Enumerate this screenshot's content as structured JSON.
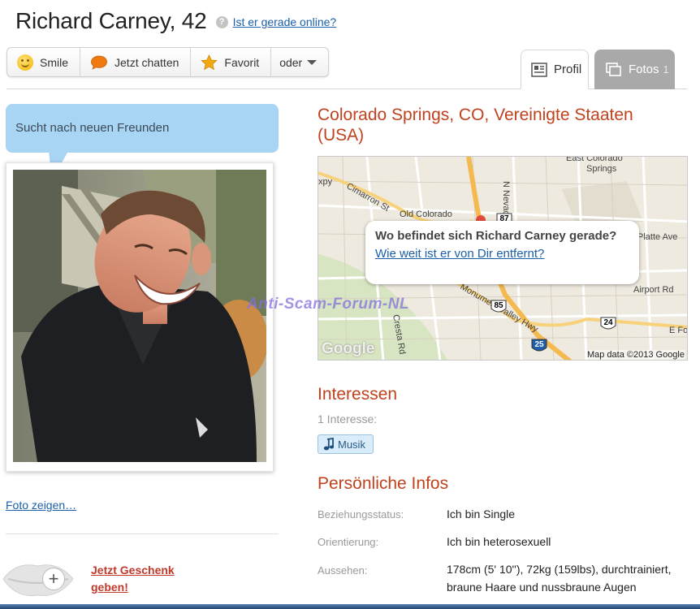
{
  "profile": {
    "name_age": "Richard Carney, 42",
    "online_link": "Ist er gerade online?",
    "help_glyph": "?"
  },
  "actions": [
    {
      "label": "Smile",
      "icon": "smile-icon"
    },
    {
      "label": "Jetzt chatten",
      "icon": "chat-bubble-icon"
    },
    {
      "label": "Favorit",
      "icon": "star-icon"
    },
    {
      "label": "oder",
      "icon": "chevron-down-icon"
    }
  ],
  "tabs": {
    "profil": "Profil",
    "fotos": "Fotos",
    "fotos_count": "1"
  },
  "status_bubble": "Sucht nach neuen Freunden",
  "photo_link": "Foto zeigen…",
  "gift": {
    "line1": "Jetzt Geschenk",
    "line2": "geben!",
    "badge_glyph": "+",
    "icon": "lips-gift-icon"
  },
  "location": "Colorado Springs, CO, Vereinigte Staaten (USA)",
  "map": {
    "question": "Wo befindet sich Richard Carney gerade?",
    "distance_link": "Wie weit ist er von Dir entfernt?",
    "credit": "Map data ©2013 Google",
    "logo": "Google",
    "labels": [
      "East Colorado",
      "Springs",
      "Old Colorado",
      "Cimarron St",
      "N Nevada",
      "Platte Ave",
      "Airport Rd",
      "Cresta Rd",
      "Monument Valley Hwy",
      "E Fo",
      "xpy"
    ],
    "shields": [
      "87",
      "85",
      "24",
      "25"
    ],
    "colors": {
      "land": "#efeadf",
      "highway": "#f4b94f",
      "road": "#ffffff",
      "park": "#cfe3b5"
    }
  },
  "watermark": "Anti-Scam-Forum-NL",
  "interests": {
    "title": "Interessen",
    "count_label": "1 Interesse:",
    "items": [
      {
        "label": "Musik",
        "icon": "music-note-icon"
      }
    ]
  },
  "personal": {
    "title": "Persönliche Infos",
    "rows": [
      {
        "label": "Beziehungsstatus:",
        "value": "Ich bin Single"
      },
      {
        "label": "Orientierung:",
        "value": "Ich bin heterosexuell"
      },
      {
        "label": "Aussehen:",
        "value": "178cm (5' 10''), 72kg (159lbs), durchtrainiert, braune Haare und nussbraune Augen"
      }
    ]
  },
  "colors": {
    "accent": "#c0421e",
    "link": "#1c5fa8",
    "bubble": "#a9d5f5",
    "tab_inactive": "#a9a9a9"
  }
}
